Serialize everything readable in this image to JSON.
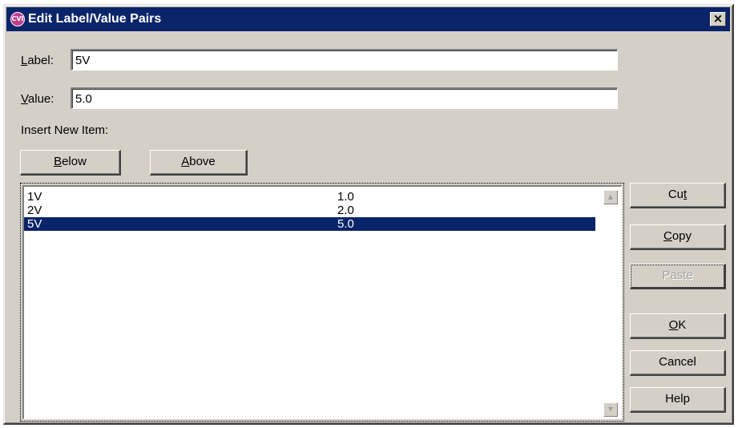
{
  "window": {
    "title": "Edit Label/Value Pairs",
    "app_icon_text": "CVI",
    "close_glyph": "×"
  },
  "fields": {
    "label": {
      "caption_mnemonic": "L",
      "caption_rest": "abel:",
      "value": "5V"
    },
    "value": {
      "caption_mnemonic": "V",
      "caption_rest": "alue:",
      "value": "5.0"
    }
  },
  "insert_section": {
    "heading": "Insert New Item:",
    "below_mnemonic": "B",
    "below_rest": "elow",
    "above_mnemonic": "A",
    "above_rest": "bove"
  },
  "list": {
    "items": [
      {
        "label": "1V",
        "value": "1.0",
        "selected": false
      },
      {
        "label": "2V",
        "value": "2.0",
        "selected": false
      },
      {
        "label": "5V",
        "value": "5.0",
        "selected": true
      }
    ],
    "scroll_up_glyph": "▲",
    "scroll_down_glyph": "▼"
  },
  "buttons": {
    "cut_pre": "Cu",
    "cut_mnemonic": "t",
    "copy_mnemonic": "C",
    "copy_rest": "opy",
    "paste_label": "Paste",
    "ok_mnemonic": "O",
    "ok_rest": "K",
    "cancel_label": "Cancel",
    "help_label": "Help"
  },
  "colors": {
    "title_bar": "#0a246a",
    "selection": "#0a246a",
    "face": "#d4d0c8"
  },
  "icons": {
    "app": "labwindows-cvi-icon",
    "close": "close-icon",
    "scroll_up": "scroll-up-arrow-icon",
    "scroll_down": "scroll-down-arrow-icon"
  }
}
